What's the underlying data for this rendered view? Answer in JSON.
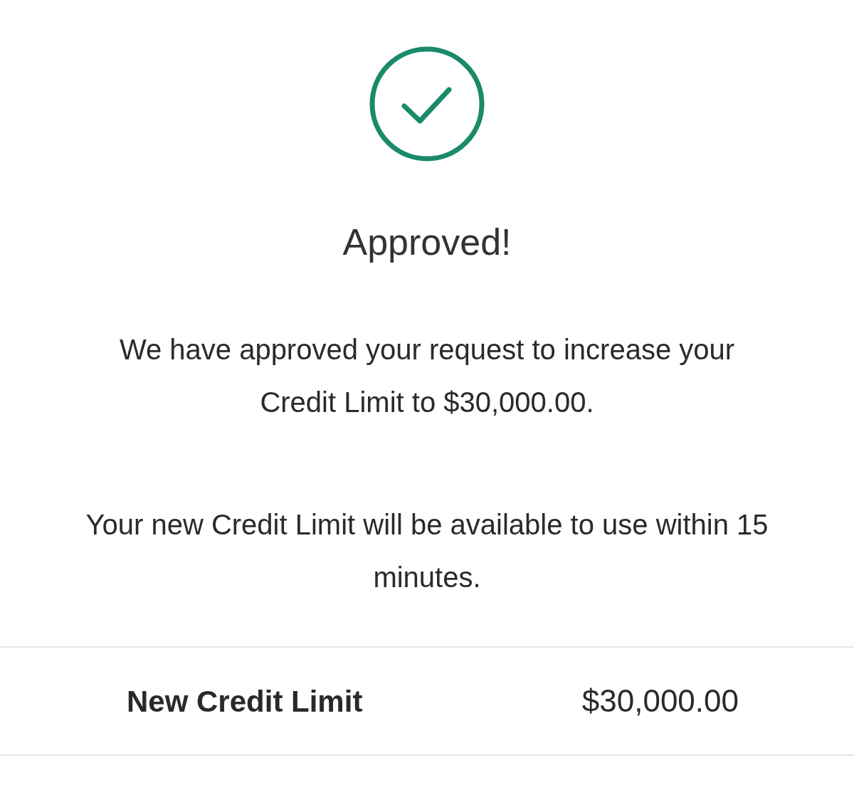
{
  "title": "Approved!",
  "paragraphs": [
    "We have approved your request to increase your Credit Limit to $30,000.00.",
    "Your new Credit Limit will be available to use within 15 minutes."
  ],
  "summary": {
    "label": "New Credit Limit",
    "value": "$30,000.00"
  }
}
